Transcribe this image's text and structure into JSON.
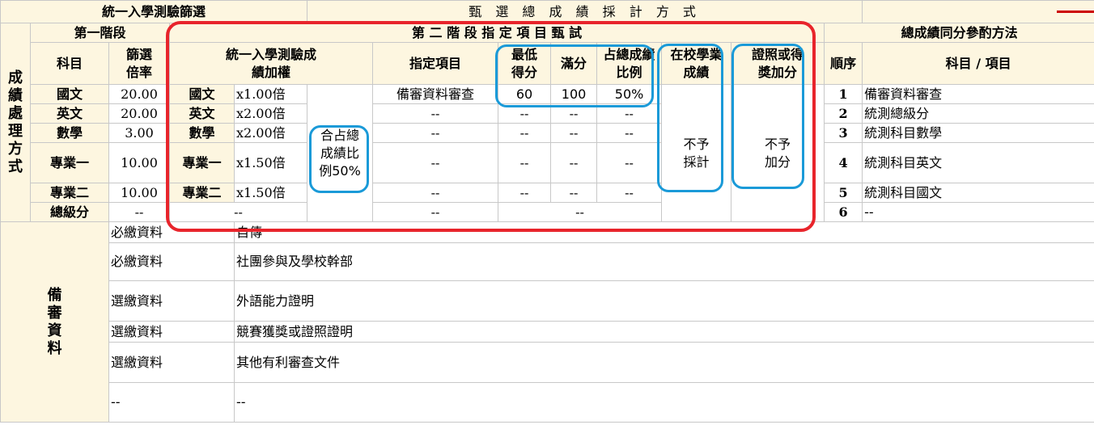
{
  "header": {
    "screening_title": "統一入學測驗篩選",
    "main_title": "甄 選 總 成 績 採 計 方 式",
    "stage1": "第一階段",
    "stage2": "第 二 階 段 指 定 項 目 甄 試",
    "tiebreak": "總成績同分參酌方法",
    "processing_method": "成績處理方式",
    "subject": "科目",
    "screening_ratio": "篩選倍率",
    "weighting": "統一入學測驗成績加權",
    "designated_item": "指定項目",
    "min_score": "最低得分",
    "full_score": "滿分",
    "share_ratio": "占總成績比例",
    "school_grades": "在校學業成績",
    "certificate_bonus": "證照或得獎加分",
    "order": "順序",
    "subject_item": "科目 / 項目"
  },
  "rows": [
    {
      "subject": "國文",
      "ratio": "20.00",
      "w_subject": "國文",
      "weight": "x1.00倍",
      "item": "備審資料審查",
      "min": "60",
      "full": "100",
      "share": "50%",
      "order": "1",
      "tb": "備審資料審查"
    },
    {
      "subject": "英文",
      "ratio": "20.00",
      "w_subject": "英文",
      "weight": "x2.00倍",
      "item": "--",
      "min": "--",
      "full": "--",
      "share": "--",
      "order": "2",
      "tb": "統測總級分"
    },
    {
      "subject": "數學",
      "ratio": "3.00",
      "w_subject": "數學",
      "weight": "x2.00倍",
      "item": "--",
      "min": "--",
      "full": "--",
      "share": "--",
      "order": "3",
      "tb": "統測科目數學"
    },
    {
      "subject": "專業一",
      "ratio": "10.00",
      "w_subject": "專業一",
      "weight": "x1.50倍",
      "item": "--",
      "min": "--",
      "full": "--",
      "share": "--",
      "order": "4",
      "tb": "統測科目英文"
    },
    {
      "subject": "專業二",
      "ratio": "10.00",
      "w_subject": "專業二",
      "weight": "x1.50倍",
      "item": "--",
      "min": "--",
      "full": "--",
      "share": "--",
      "order": "5",
      "tb": "統測科目國文"
    }
  ],
  "total_row": {
    "subject": "總級分",
    "ratio": "--",
    "weight": "--",
    "item": "--",
    "merged": "--",
    "order": "6",
    "tb": "--"
  },
  "combined_share": "合占總成績比例50%",
  "school_grades_value": "不予採計",
  "certificate_value": "不予加分",
  "review": {
    "label": "備審資料",
    "items": [
      {
        "type": "必繳資料",
        "name": "自傳"
      },
      {
        "type": "必繳資料",
        "name": "社團參與及學校幹部"
      },
      {
        "type": "選繳資料",
        "name": "外語能力證明"
      },
      {
        "type": "選繳資料",
        "name": "競賽獲獎或證照證明"
      },
      {
        "type": "選繳資料",
        "name": "其他有利審查文件"
      },
      {
        "type": "--",
        "name": "--"
      }
    ]
  },
  "colors": {
    "header_bg": "#fdf6e0",
    "grid": "#c8c8c8",
    "red_box": "#e8242b",
    "blue_box": "#1a9ad8"
  }
}
